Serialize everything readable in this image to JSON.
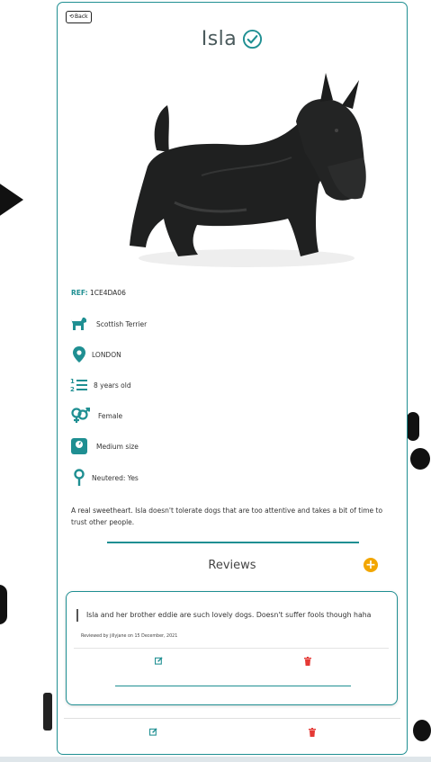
{
  "back": {
    "label": "Back"
  },
  "dog": {
    "name": "Isla",
    "ref_label": "REF:",
    "ref_value": "1CE4DA06",
    "breed": "Scottish Terrier",
    "location": "LONDON",
    "age": "8 years old",
    "gender": "Female",
    "size": "Medium size",
    "neutered": "Neutered: Yes",
    "description": "A real sweetheart. Isla doesn't tolerate dogs that are too attentive and takes a bit of time to trust other people."
  },
  "reviews": {
    "title": "Reviews",
    "items": [
      {
        "text": "Isla and her brother eddie are such lovely dogs. Doesn't suffer fools though haha",
        "meta": "Reviewed by jillyjane on 15 December, 2021"
      }
    ]
  },
  "icons": {
    "verified": "check-circle-icon",
    "breed": "dog-icon",
    "location": "map-marker-icon",
    "age": "numbered-list-icon",
    "gender": "venus-mars-icon",
    "size": "weight-scale-icon",
    "neutered": "venus-icon",
    "edit": "edit-icon",
    "delete": "trash-icon",
    "add": "plus-circle-icon"
  },
  "colors": {
    "accent": "#1f8f92",
    "add": "#f2a600",
    "delete": "#e53935"
  }
}
